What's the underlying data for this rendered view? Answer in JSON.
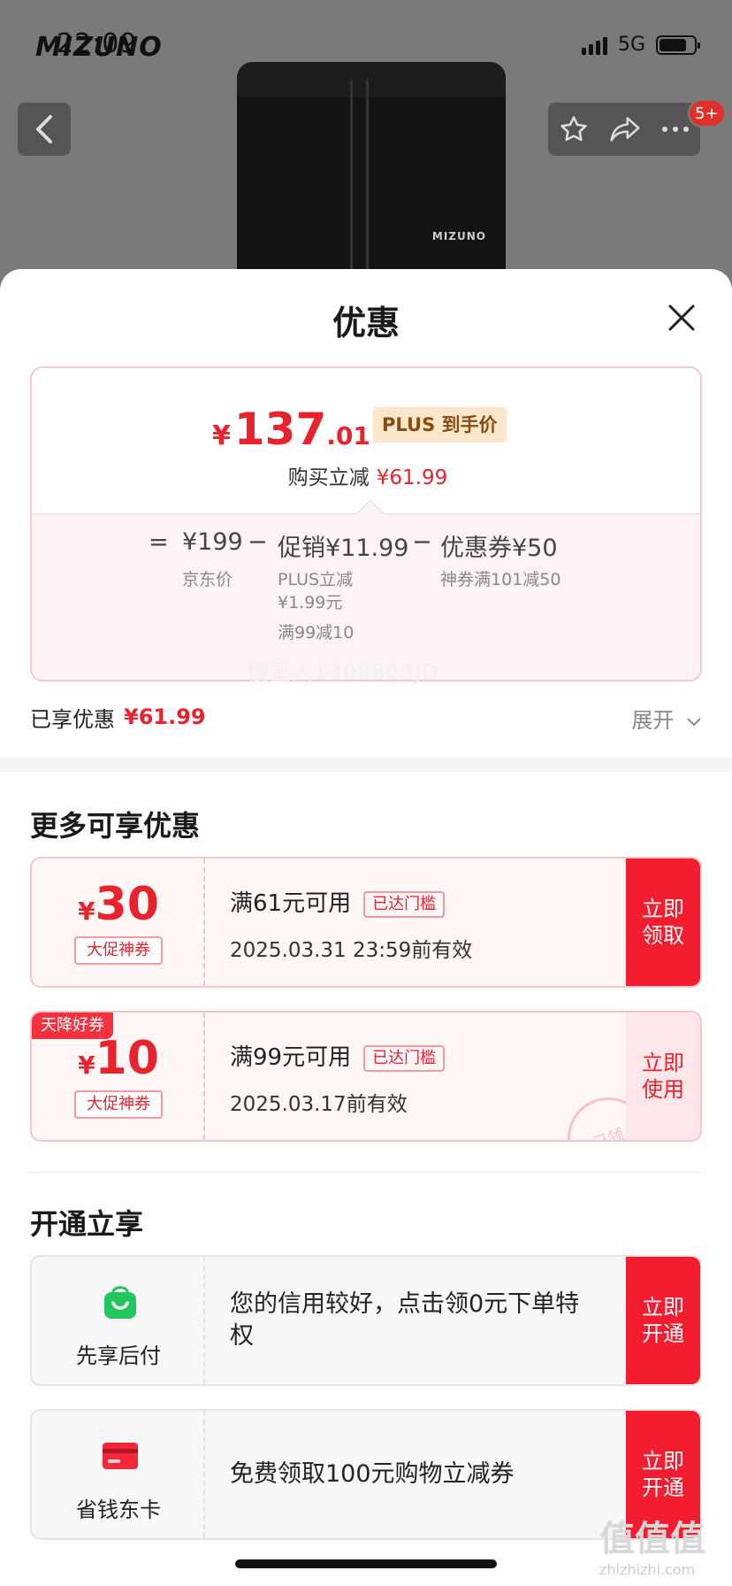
{
  "status_bar": {
    "time": "22:09",
    "network": "5G"
  },
  "product": {
    "brand": "MIZUNO",
    "small_logo": "MIZUNO"
  },
  "header": {
    "back_icon": "chevron-left-icon",
    "badge": "5+"
  },
  "sheet": {
    "title": "优惠",
    "price": {
      "currency": "¥",
      "integer": "137",
      "decimal": ".01",
      "plus_tag": "PLUS 到手价",
      "instant_label": "购买立减",
      "instant_value": "¥61.99"
    },
    "calc": {
      "equals": "=",
      "base_price": "¥199",
      "base_label": "京东价",
      "minus1": "−",
      "promo": "促销¥11.99",
      "promo_sub1": "PLUS立减",
      "promo_sub2": "¥1.99元",
      "promo_sub3": "满99减10",
      "minus2": "−",
      "coupon": "优惠券¥50",
      "coupon_sub": "神券满101减50"
    },
    "saved": {
      "label": "已享优惠",
      "value": "¥61.99",
      "expand": "展开"
    },
    "watermark": "慢星人1308823JD"
  },
  "more_offers": {
    "title": "更多可享优惠",
    "coupons": [
      {
        "currency": "¥",
        "amount": "30",
        "kind": "大促神券",
        "condition": "满61元可用",
        "tag": "已达门槛",
        "valid": "2025.03.31 23:59前有效",
        "action": "立即领取"
      },
      {
        "corner_tag": "天降好券",
        "currency": "¥",
        "amount": "10",
        "kind": "大促神券",
        "condition": "满99元可用",
        "tag": "已达门槛",
        "valid": "2025.03.17前有效",
        "action": "立即使用",
        "stamp": "已领"
      }
    ]
  },
  "open_enjoy": {
    "title": "开通立享",
    "items": [
      {
        "icon": "shopping-bag-icon",
        "label": "先享后付",
        "desc": "您的信用较好，点击领0元下单特权",
        "action": "立即开通",
        "color": "#22c55e"
      },
      {
        "icon": "card-icon",
        "label": "省钱东卡",
        "desc": "免费领取100元购物立减券",
        "action": "立即开通",
        "color": "#f0283a"
      }
    ]
  },
  "footer_mark": {
    "main": "值值值",
    "sub": "zhizhizhi.com"
  },
  "colors": {
    "accent": "#e8232e",
    "button": "#f21d2f",
    "plus_tag_bg": "#fbe8cc"
  }
}
